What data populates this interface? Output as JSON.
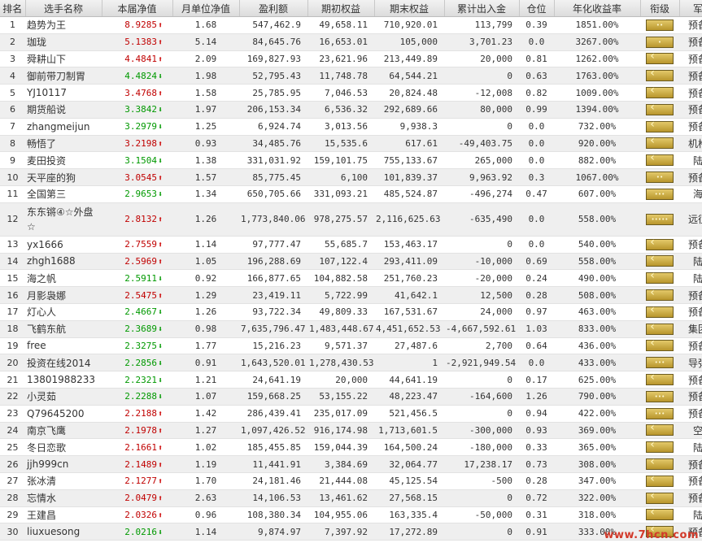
{
  "headers": [
    "排名",
    "选手名称",
    "本届净值",
    "月单位净值",
    "盈利额",
    "期初权益",
    "期末权益",
    "累计出入金",
    "仓位",
    "年化收益率",
    "衔级",
    "军种"
  ],
  "rows": [
    {
      "rank": "1",
      "name": "趋势为王",
      "nav": "8.9285",
      "dir": "up",
      "monthly": "1.68",
      "profit": "547,462.9",
      "start": "49,658.11",
      "end": "710,920.01",
      "flow": "113,799",
      "pos": "0.39",
      "annual": "1851.00%",
      "badge": "••",
      "chev": false,
      "army": "预备役"
    },
    {
      "rank": "2",
      "name": "珈珑",
      "nav": "5.1383",
      "dir": "up",
      "monthly": "5.14",
      "profit": "84,645.76",
      "start": "16,653.01",
      "end": "105,000",
      "flow": "3,701.23",
      "pos": "0.0",
      "annual": "3267.00%",
      "badge": "•",
      "chev": false,
      "army": "预备役"
    },
    {
      "rank": "3",
      "name": "舜耕山下",
      "nav": "4.4841",
      "dir": "up",
      "monthly": "2.09",
      "profit": "169,827.93",
      "start": "23,621.96",
      "end": "213,449.89",
      "flow": "20,000",
      "pos": "0.81",
      "annual": "1262.00%",
      "badge": "",
      "chev": true,
      "army": "预备役"
    },
    {
      "rank": "4",
      "name": "御前带刀制胃",
      "nav": "4.4824",
      "dir": "down",
      "monthly": "1.98",
      "profit": "52,795.43",
      "start": "11,748.78",
      "end": "64,544.21",
      "flow": "0",
      "pos": "0.63",
      "annual": "1763.00%",
      "badge": "",
      "chev": true,
      "army": "预备役"
    },
    {
      "rank": "5",
      "name": "YJ10117",
      "nav": "3.4768",
      "dir": "up",
      "monthly": "1.58",
      "profit": "25,785.95",
      "start": "7,046.53",
      "end": "20,824.48",
      "flow": "-12,008",
      "pos": "0.82",
      "annual": "1009.00%",
      "badge": "",
      "chev": true,
      "army": "预备役"
    },
    {
      "rank": "6",
      "name": "期货船说",
      "nav": "3.3842",
      "dir": "down",
      "monthly": "1.97",
      "profit": "206,153.34",
      "start": "6,536.32",
      "end": "292,689.66",
      "flow": "80,000",
      "pos": "0.99",
      "annual": "1394.00%",
      "badge": "",
      "chev": true,
      "army": "预备役"
    },
    {
      "rank": "7",
      "name": "zhangmeijun",
      "nav": "3.2979",
      "dir": "down",
      "monthly": "1.25",
      "profit": "6,924.74",
      "start": "3,013.56",
      "end": "9,938.3",
      "flow": "0",
      "pos": "0.0",
      "annual": "732.00%",
      "badge": "",
      "chev": true,
      "army": "预备役"
    },
    {
      "rank": "8",
      "name": "畅悟了",
      "nav": "3.2198",
      "dir": "up",
      "monthly": "0.93",
      "profit": "34,485.76",
      "start": "15,535.6",
      "end": "617.61",
      "flow": "-49,403.75",
      "pos": "0.0",
      "annual": "920.00%",
      "badge": "",
      "chev": true,
      "army": "机枪手"
    },
    {
      "rank": "9",
      "name": "麦田投资",
      "nav": "3.1504",
      "dir": "down",
      "monthly": "1.38",
      "profit": "331,031.92",
      "start": "159,101.75",
      "end": "755,133.67",
      "flow": "265,000",
      "pos": "0.0",
      "annual": "882.00%",
      "badge": "",
      "chev": true,
      "army": "陆军"
    },
    {
      "rank": "10",
      "name": "天平座的狗",
      "nav": "3.0545",
      "dir": "up",
      "monthly": "1.57",
      "profit": "85,775.45",
      "start": "6,100",
      "end": "101,839.37",
      "flow": "9,963.92",
      "pos": "0.3",
      "annual": "1067.00%",
      "badge": "••",
      "chev": false,
      "army": "预备役"
    },
    {
      "rank": "11",
      "name": "全国第三",
      "nav": "2.9653",
      "dir": "down",
      "monthly": "1.34",
      "profit": "650,705.66",
      "start": "331,093.21",
      "end": "485,524.87",
      "flow": "-496,274",
      "pos": "0.47",
      "annual": "607.00%",
      "badge": "•••",
      "chev": false,
      "army": "海军"
    },
    {
      "rank": "12",
      "name": "东东锵④☆外盘☆",
      "nav": "2.8132",
      "dir": "up",
      "monthly": "1.26",
      "profit": "1,773,840.06",
      "start": "978,275.57",
      "end": "2,116,625.63",
      "flow": "-635,490",
      "pos": "0.0",
      "annual": "558.00%",
      "badge": "•••••",
      "chev": false,
      "army": "远征军",
      "tall": true
    },
    {
      "rank": "13",
      "name": "yx1666",
      "nav": "2.7559",
      "dir": "up",
      "monthly": "1.14",
      "profit": "97,777.47",
      "start": "55,685.7",
      "end": "153,463.17",
      "flow": "0",
      "pos": "0.0",
      "annual": "540.00%",
      "badge": "",
      "chev": true,
      "army": "预备役"
    },
    {
      "rank": "14",
      "name": "zhgh1688",
      "nav": "2.5969",
      "dir": "up",
      "monthly": "1.05",
      "profit": "196,288.69",
      "start": "107,122.4",
      "end": "293,411.09",
      "flow": "-10,000",
      "pos": "0.69",
      "annual": "558.00%",
      "badge": "",
      "chev": true,
      "army": "陆军"
    },
    {
      "rank": "15",
      "name": "海之帆",
      "nav": "2.5911",
      "dir": "down",
      "monthly": "0.92",
      "profit": "166,877.65",
      "start": "104,882.58",
      "end": "251,760.23",
      "flow": "-20,000",
      "pos": "0.24",
      "annual": "490.00%",
      "badge": "",
      "chev": true,
      "army": "陆军"
    },
    {
      "rank": "16",
      "name": "月影袅娜",
      "nav": "2.5475",
      "dir": "up",
      "monthly": "1.29",
      "profit": "23,419.11",
      "start": "5,722.99",
      "end": "41,642.1",
      "flow": "12,500",
      "pos": "0.28",
      "annual": "508.00%",
      "badge": "",
      "chev": true,
      "army": "预备役"
    },
    {
      "rank": "17",
      "name": "灯心人",
      "nav": "2.4667",
      "dir": "down",
      "monthly": "1.26",
      "profit": "93,722.34",
      "start": "49,809.33",
      "end": "167,531.67",
      "flow": "24,000",
      "pos": "0.97",
      "annual": "463.00%",
      "badge": "",
      "chev": true,
      "army": "预备役"
    },
    {
      "rank": "18",
      "name": "飞鹤东航",
      "nav": "2.3689",
      "dir": "down",
      "monthly": "0.98",
      "profit": "7,635,796.47",
      "start": "1,483,448.67",
      "end": "4,451,652.53",
      "flow": "-4,667,592.61",
      "pos": "1.03",
      "annual": "833.00%",
      "badge": "",
      "chev": true,
      "army": "集团军"
    },
    {
      "rank": "19",
      "name": "free",
      "nav": "2.3275",
      "dir": "down",
      "monthly": "1.77",
      "profit": "15,216.23",
      "start": "9,571.37",
      "end": "27,487.6",
      "flow": "2,700",
      "pos": "0.64",
      "annual": "436.00%",
      "badge": "",
      "chev": true,
      "army": "预备役"
    },
    {
      "rank": "20",
      "name": "投资在线2014",
      "nav": "2.2856",
      "dir": "down",
      "monthly": "0.91",
      "profit": "1,643,520.01",
      "start": "1,278,430.53",
      "end": "1",
      "flow": "-2,921,949.54",
      "pos": "0.0",
      "annual": "433.00%",
      "badge": "•••",
      "chev": false,
      "army": "导弹部"
    },
    {
      "rank": "21",
      "name": "13801988233",
      "nav": "2.2321",
      "dir": "down",
      "monthly": "1.21",
      "profit": "24,641.19",
      "start": "20,000",
      "end": "44,641.19",
      "flow": "0",
      "pos": "0.17",
      "annual": "625.00%",
      "badge": "",
      "chev": true,
      "army": "预备役"
    },
    {
      "rank": "22",
      "name": "小灵茹",
      "nav": "2.2288",
      "dir": "down",
      "monthly": "1.07",
      "profit": "159,668.25",
      "start": "53,155.22",
      "end": "48,223.47",
      "flow": "-164,600",
      "pos": "1.26",
      "annual": "790.00%",
      "badge": "•••",
      "chev": false,
      "army": "预备役"
    },
    {
      "rank": "23",
      "name": "Q79645200",
      "nav": "2.2188",
      "dir": "up",
      "monthly": "1.42",
      "profit": "286,439.41",
      "start": "235,017.09",
      "end": "521,456.5",
      "flow": "0",
      "pos": "0.94",
      "annual": "422.00%",
      "badge": "•••",
      "chev": false,
      "army": "预备役"
    },
    {
      "rank": "24",
      "name": "南京飞鹰",
      "nav": "2.1978",
      "dir": "up",
      "monthly": "1.27",
      "profit": "1,097,426.52",
      "start": "916,174.98",
      "end": "1,713,601.5",
      "flow": "-300,000",
      "pos": "0.93",
      "annual": "369.00%",
      "badge": "",
      "chev": true,
      "army": "空军"
    },
    {
      "rank": "25",
      "name": "冬日恋歌",
      "nav": "2.1661",
      "dir": "up",
      "monthly": "1.02",
      "profit": "185,455.85",
      "start": "159,044.39",
      "end": "164,500.24",
      "flow": "-180,000",
      "pos": "0.33",
      "annual": "365.00%",
      "badge": "",
      "chev": true,
      "army": "陆军"
    },
    {
      "rank": "26",
      "name": "jjh999cn",
      "nav": "2.1489",
      "dir": "up",
      "monthly": "1.19",
      "profit": "11,441.91",
      "start": "3,384.69",
      "end": "32,064.77",
      "flow": "17,238.17",
      "pos": "0.73",
      "annual": "308.00%",
      "badge": "",
      "chev": true,
      "army": "预备役"
    },
    {
      "rank": "27",
      "name": "张冰清",
      "nav": "2.1277",
      "dir": "up",
      "monthly": "1.70",
      "profit": "24,181.46",
      "start": "21,444.08",
      "end": "45,125.54",
      "flow": "-500",
      "pos": "0.28",
      "annual": "347.00%",
      "badge": "",
      "chev": true,
      "army": "预备役"
    },
    {
      "rank": "28",
      "name": "忘情水",
      "nav": "2.0479",
      "dir": "up",
      "monthly": "2.63",
      "profit": "14,106.53",
      "start": "13,461.62",
      "end": "27,568.15",
      "flow": "0",
      "pos": "0.72",
      "annual": "322.00%",
      "badge": "",
      "chev": true,
      "army": "预备役"
    },
    {
      "rank": "29",
      "name": "王建昌",
      "nav": "2.0326",
      "dir": "up",
      "monthly": "0.96",
      "profit": "108,380.34",
      "start": "104,955.06",
      "end": "163,335.4",
      "flow": "-50,000",
      "pos": "0.31",
      "annual": "318.00%",
      "badge": "",
      "chev": true,
      "army": "陆军"
    },
    {
      "rank": "30",
      "name": "liuxuesong",
      "nav": "2.0216",
      "dir": "down",
      "monthly": "1.14",
      "profit": "9,874.97",
      "start": "7,397.92",
      "end": "17,272.89",
      "flow": "0",
      "pos": "0.91",
      "annual": "333.00%",
      "badge": "",
      "chev": true,
      "army": "预备役"
    }
  ],
  "watermark": "www.7hcn.com",
  "colors": {
    "up": "#c00000",
    "down": "#009900",
    "badge": "#c9a94a",
    "watermark": "#d23a2a"
  }
}
